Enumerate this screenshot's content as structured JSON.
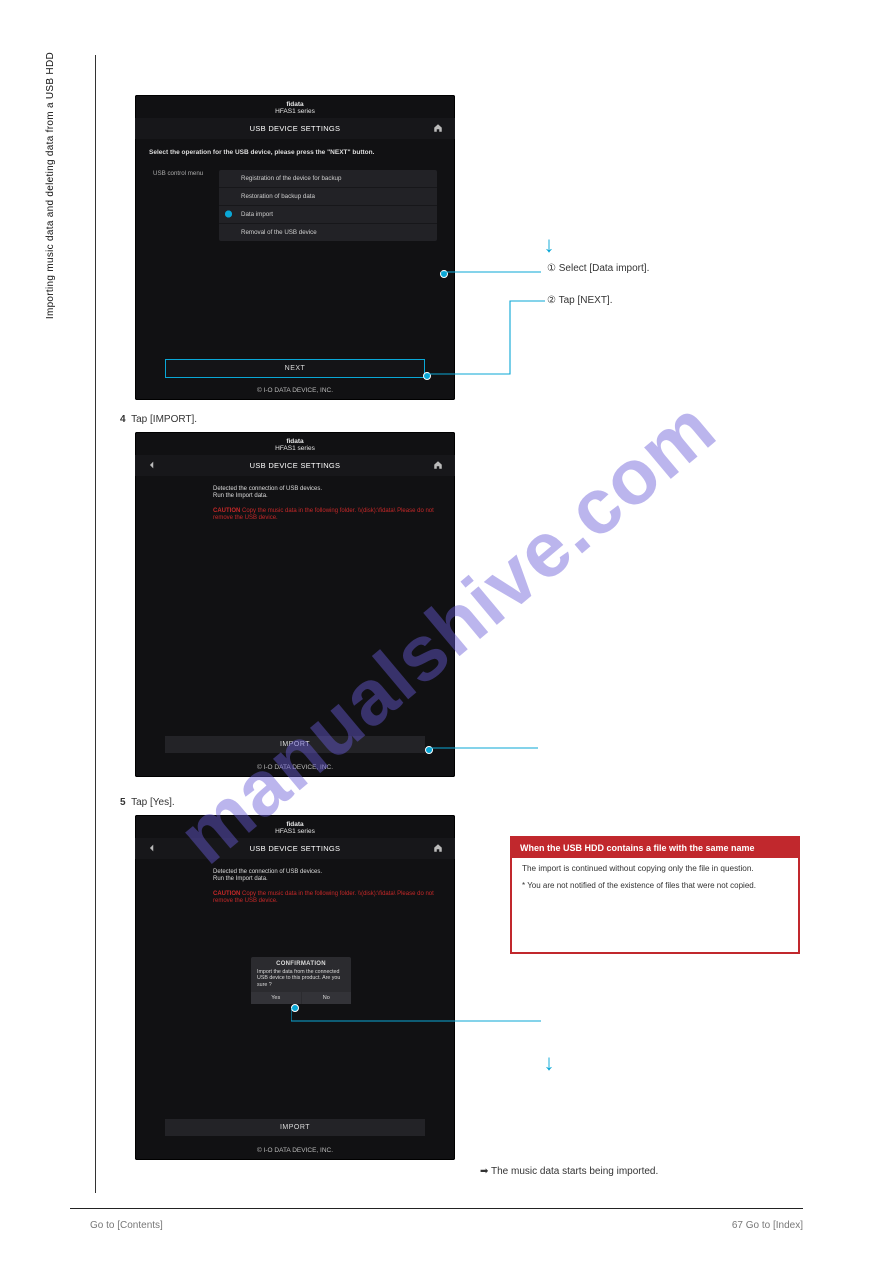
{
  "page": {
    "section_label_vertical": "Importing music data and deleting data from a USB HDD",
    "footer_left": "Go to [Contents]",
    "footer_right": "67  Go to [Index]"
  },
  "shot_head": {
    "brand": "fidata",
    "series": "HFAS1 series"
  },
  "shot1": {
    "title": "USB DEVICE SETTINGS",
    "instruction": "Select the operation for the USB device, please press the \"NEXT\" button.",
    "menu_label": "USB control menu",
    "options": [
      "Registration of the device for backup",
      "Restoration of backup data",
      "Data import",
      "Removal of the USB device"
    ],
    "next_btn": "NEXT",
    "footer": "© I-O DATA DEVICE, INC.",
    "ann_a_prefix": "①",
    "ann_a_text": "Select [Data import].",
    "ann_b_prefix": "②",
    "ann_b_text": "Tap [NEXT]."
  },
  "step4": {
    "num": "4",
    "text": "Tap [IMPORT]."
  },
  "shot2": {
    "title": "USB DEVICE SETTINGS",
    "info_line1": "Detected the connection of USB devices.",
    "info_line2": "Run the Import data.",
    "caution_label": "CAUTION",
    "caution_text": "Copy the music data in the following folder.\n\\\\(disk):\\fidata\\ Please do not remove the USB device.",
    "import_btn": "IMPORT",
    "footer": "© I-O DATA DEVICE, INC."
  },
  "step5": {
    "num": "5",
    "text": "Tap [Yes]."
  },
  "shot3": {
    "title": "USB DEVICE SETTINGS",
    "info_line1": "Detected the connection of USB devices.",
    "info_line2": "Run the Import data.",
    "caution_label": "CAUTION",
    "caution_text": "Copy the music data in the following folder.\n\\\\(disk):\\fidata\\ Please do not remove the USB device.",
    "confirm_title": "CONFIRMATION",
    "confirm_msg": "Import the data from the connected USB device to this product.\nAre you sure ?",
    "yes": "Yes",
    "no": "No",
    "import_btn": "IMPORT",
    "footer": "© I-O DATA DEVICE, INC.",
    "below_note": "➡ The music data starts being imported."
  },
  "callout": {
    "head": "When the USB HDD contains a file with the same name",
    "body": "The import is continued without copying only the file in question.",
    "sub_label": "*",
    "sub_text": "You are not notified of the existence of files that were not copied."
  },
  "watermark": "manualshive.com"
}
